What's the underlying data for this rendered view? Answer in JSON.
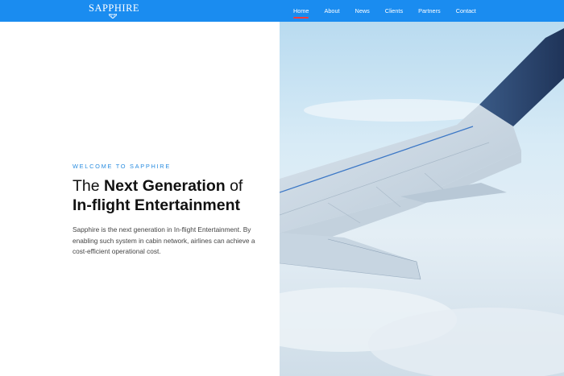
{
  "header": {
    "logo": {
      "text": "SAPPHIRE",
      "icon": "diamond-icon"
    },
    "nav": [
      {
        "label": "Home",
        "active": true
      },
      {
        "label": "About",
        "active": false
      },
      {
        "label": "News",
        "active": false
      },
      {
        "label": "Clients",
        "active": false
      },
      {
        "label": "Partners",
        "active": false
      },
      {
        "label": "Contact",
        "active": false
      }
    ]
  },
  "hero": {
    "eyebrow": "WELCOME TO SAPPHIRE",
    "title_part1": "The ",
    "title_bold1": "Next Generation",
    "title_part2": " of",
    "title_bold2": "In-flight Entertainment",
    "description": "Sapphire is the next generation in In-flight Entertainment. By enabling such system in cabin network, airlines can achieve a cost-efficient operational cost.",
    "image": "airplane-wing-image"
  },
  "colors": {
    "header_bg": "#1a8cf0",
    "accent": "#2a8de0",
    "active_underline": "#ff3b3b"
  }
}
